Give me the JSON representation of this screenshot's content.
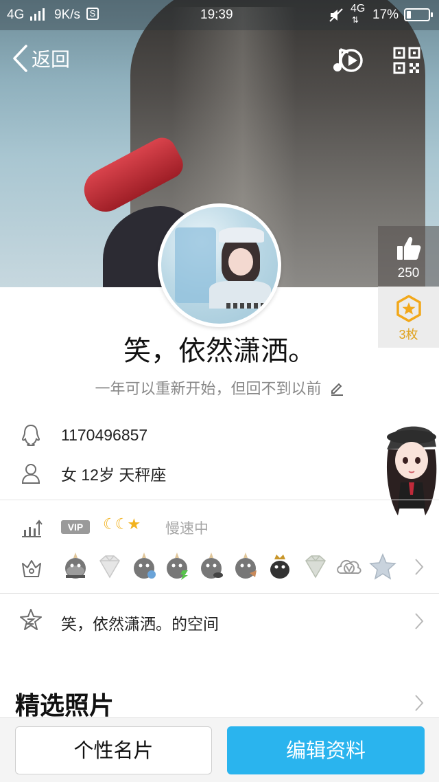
{
  "status_bar": {
    "network": "4G",
    "speed": "9K/s",
    "speed_icon": "S",
    "time": "19:39",
    "network2": "4G",
    "battery": "17%"
  },
  "nav": {
    "back_label": "返回",
    "music_icon": "music-play-icon",
    "qr_icon": "qr-code-icon"
  },
  "cover": {
    "likes": "250",
    "medals": "3枚",
    "accent_like_bg": "#55504e",
    "medal_color": "#e0a21c"
  },
  "profile": {
    "nickname": "笑，依然潇洒。",
    "signature": "一年可以重新开始，但回不到以前",
    "qq_number": "1170496857",
    "details": "女  12岁  天秤座"
  },
  "vip": {
    "badge": "VIP",
    "level_icons": [
      "moon",
      "moon",
      "star"
    ],
    "status": "慢速中"
  },
  "badges": {
    "items": [
      "penguin-badge",
      "diamond-badge",
      "penguin-badge",
      "penguin-badge",
      "penguin-badge",
      "penguin-badge",
      "penguin-crown-badge",
      "diamond-badge",
      "cloud-v-badge",
      "star-badge"
    ]
  },
  "qzone": {
    "label": "笑，依然潇洒。的空间"
  },
  "photos": {
    "title": "精选照片"
  },
  "bottom": {
    "card_button": "个性名片",
    "edit_button": "编辑资料",
    "edit_color": "#2ab4ee"
  }
}
